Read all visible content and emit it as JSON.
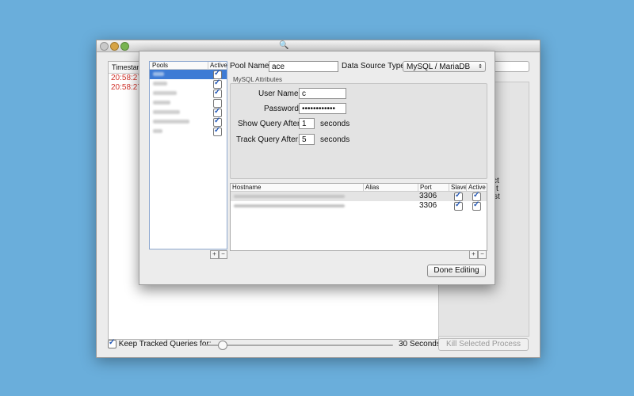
{
  "background_window": {
    "timestamp_header": "Timestamp",
    "timestamps": [
      "20:58:27",
      "20:58:27"
    ],
    "right_panel_fragments": [
      "ct",
      "t",
      "st"
    ],
    "keep_tracked_label": "Keep Tracked Queries for:",
    "keep_tracked_checked": true,
    "keep_tracked_slider_fraction": 0.1,
    "keep_tracked_value": "30 Seconds",
    "kill_button": "Kill Selected Process"
  },
  "pools": {
    "header_pools": "Pools",
    "header_active": "Active",
    "items": [
      {
        "active": true,
        "selected": true
      },
      {
        "active": true,
        "selected": false
      },
      {
        "active": true,
        "selected": false
      },
      {
        "active": false,
        "selected": false
      },
      {
        "active": true,
        "selected": false
      },
      {
        "active": true,
        "selected": false
      },
      {
        "active": true,
        "selected": false
      }
    ],
    "add_label": "+",
    "remove_label": "−"
  },
  "form": {
    "pool_name_label": "Pool Name:",
    "pool_name_value": "ace",
    "data_source_label": "Data Source Type:",
    "data_source_value": "MySQL / MariaDB",
    "group_title": "MySQL Attributes",
    "user_name_label": "User Name:",
    "user_name_value": "c",
    "password_label": "Password:",
    "password_value": "••••••••••••",
    "show_query_label": "Show Query After:",
    "show_query_value": "1",
    "show_query_unit": "seconds",
    "track_query_label": "Track Query After:",
    "track_query_value": "5",
    "track_query_unit": "seconds"
  },
  "hosts": {
    "headers": {
      "hostname": "Hostname",
      "alias": "Alias",
      "port": "Port",
      "slave": "Slave",
      "active": "Active"
    },
    "rows": [
      {
        "port": "3306",
        "slave": true,
        "active": true
      },
      {
        "port": "3306",
        "slave": true,
        "active": true
      }
    ],
    "add_label": "+",
    "remove_label": "−"
  },
  "done_button": "Done Editing"
}
